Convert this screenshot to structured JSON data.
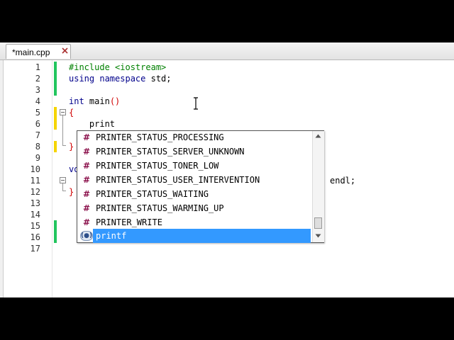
{
  "tab": {
    "label": "*main.cpp",
    "close_icon": "close-icon"
  },
  "line_numbers": [
    "1",
    "2",
    "3",
    "4",
    "5",
    "6",
    "7",
    "8",
    "9",
    "10",
    "11",
    "12",
    "13",
    "14",
    "15",
    "16",
    "17"
  ],
  "code": {
    "line1": "#include <iostream>",
    "line2_kw": "using namespace",
    "line2_rest": " std;",
    "line4_kw": "int",
    "line4_name": " main",
    "line4_parens": "()",
    "line5": "{",
    "line6": "    print",
    "line8": "}",
    "line10": "vo",
    "line11_tail": "endl;",
    "line12": "}"
  },
  "autocomplete": {
    "items": [
      {
        "label": "PRINTER_STATUS_PROCESSING",
        "icon": "macro-icon"
      },
      {
        "label": "PRINTER_STATUS_SERVER_UNKNOWN",
        "icon": "macro-icon"
      },
      {
        "label": "PRINTER_STATUS_TONER_LOW",
        "icon": "macro-icon"
      },
      {
        "label": "PRINTER_STATUS_USER_INTERVENTION",
        "icon": "macro-icon"
      },
      {
        "label": "PRINTER_STATUS_WAITING",
        "icon": "macro-icon"
      },
      {
        "label": "PRINTER_STATUS_WARMING_UP",
        "icon": "macro-icon"
      },
      {
        "label": "PRINTER_WRITE",
        "icon": "macro-icon"
      },
      {
        "label": "printf",
        "icon": "function-icon",
        "selected": true
      }
    ],
    "macro_glyph": "#",
    "function_glyph": "(●)"
  },
  "colors": {
    "selection": "#3399ff",
    "saved_change_bar": "#22c55e",
    "unsaved_change_bar": "#f5d400",
    "keyword": "#00008b",
    "preprocessor": "#008000"
  }
}
